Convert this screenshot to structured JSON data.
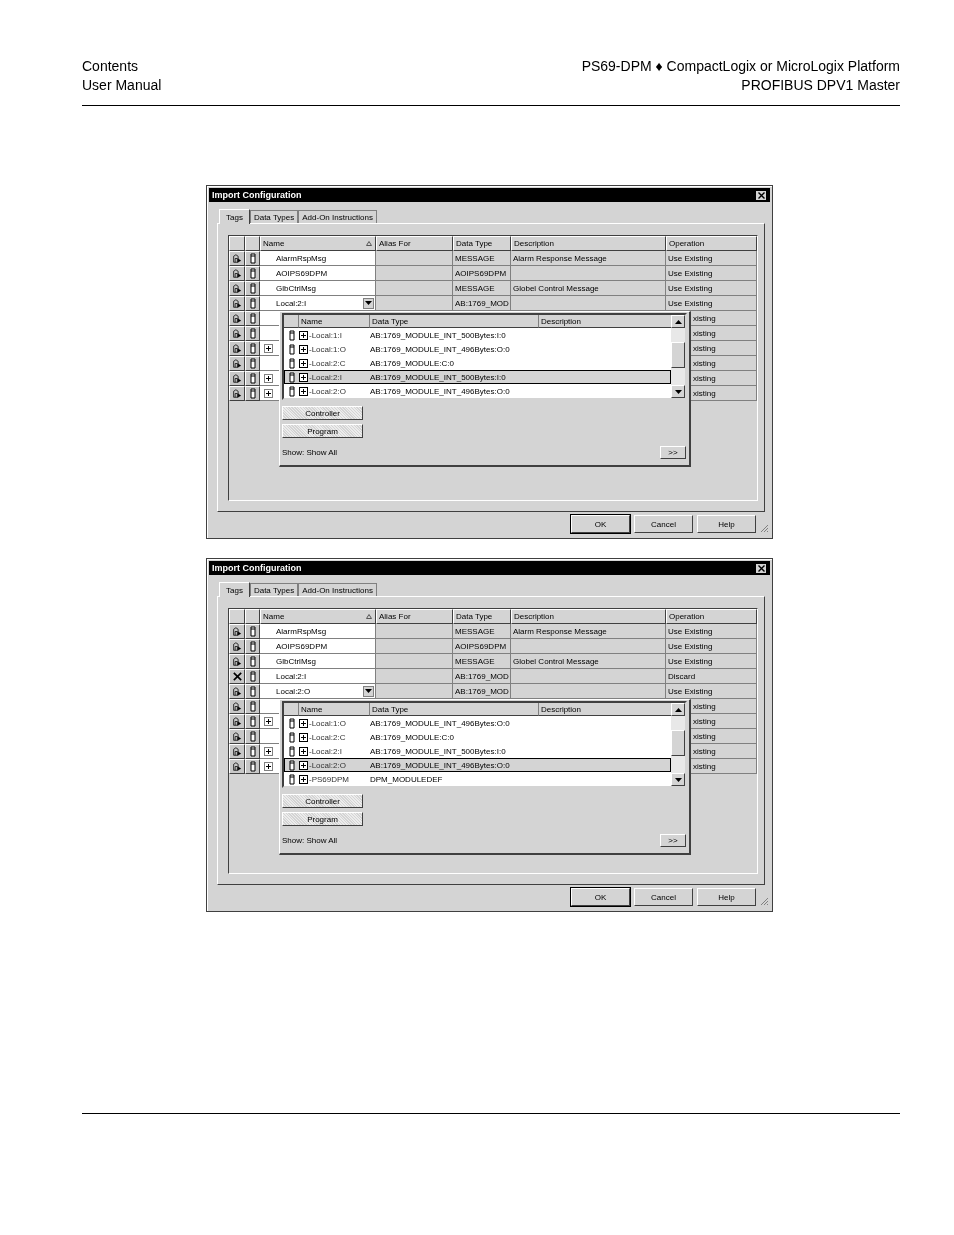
{
  "header": {
    "left": [
      "Contents",
      "User Manual"
    ],
    "right": [
      "PS69-DPM ♦ CompactLogix or MicroLogix Platform",
      "PROFIBUS DPV1 Master"
    ]
  },
  "dialogs": [
    {
      "title": "Import Configuration",
      "tabs": [
        {
          "label": "Tags",
          "selected": true
        },
        {
          "label": "Data Types",
          "selected": false
        },
        {
          "label": "Add-On Instructions",
          "selected": false
        }
      ],
      "grid": {
        "columns": [
          "Name",
          "Alias For",
          "Data Type",
          "Description",
          "Operation"
        ],
        "rows": [
          {
            "kind": "import",
            "expandable": false,
            "editing": false,
            "name": "AlarmRspMsg",
            "data_type": "MESSAGE",
            "description": "Alarm Response Message",
            "operation": "Use Existing"
          },
          {
            "kind": "import",
            "expandable": false,
            "editing": false,
            "name": "AOIPS69DPM",
            "data_type": "AOIPS69DPM",
            "operation": "Use Existing"
          },
          {
            "kind": "import",
            "expandable": false,
            "editing": false,
            "name": "GlbCtrlMsg",
            "data_type": "MESSAGE",
            "description": "Globel Control Message",
            "operation": "Use Existing"
          },
          {
            "kind": "import",
            "expandable": false,
            "editing": true,
            "name": "Local:2:I",
            "data_type": "AB:1769_MOD",
            "operation": "Use Existing"
          },
          {
            "kind": "import",
            "expandable": false,
            "editing": false,
            "operation": "xisting"
          },
          {
            "kind": "import",
            "expandable": false,
            "editing": false,
            "operation": "xisting"
          },
          {
            "kind": "import",
            "expandable": true,
            "editing": false,
            "operation": "xisting"
          },
          {
            "kind": "import",
            "expandable": false,
            "editing": false,
            "operation": "xisting"
          },
          {
            "kind": "import",
            "expandable": true,
            "editing": false,
            "operation": "xisting"
          },
          {
            "kind": "import",
            "expandable": true,
            "editing": false,
            "operation": "xisting"
          }
        ]
      },
      "popup": {
        "columns": [
          "Name",
          "Data Type",
          "Description"
        ],
        "items": [
          {
            "name": "-Local:1:I",
            "data_type": "AB:1769_MODULE_INT_500Bytes:I:0",
            "selected": false
          },
          {
            "name": "-Local:1:O",
            "data_type": "AB:1769_MODULE_INT_496Bytes:O:0",
            "selected": false
          },
          {
            "name": "-Local:2:C",
            "data_type": "AB:1769_MODULE:C:0",
            "selected": false
          },
          {
            "name": "-Local:2:I",
            "data_type": "AB:1769_MODULE_INT_500Bytes:I:0",
            "selected": true
          },
          {
            "name": "-Local:2:O",
            "data_type": "AB:1769_MODULE_INT_496Bytes:O:0",
            "selected": false
          }
        ],
        "buttons": [
          "Controller",
          "Program"
        ],
        "show": "Show: Show All",
        "more": ">>"
      },
      "buttons": [
        "OK",
        "Cancel",
        "Help"
      ]
    },
    {
      "title": "Import Configuration",
      "tabs": [
        {
          "label": "Tags",
          "selected": true
        },
        {
          "label": "Data Types",
          "selected": false
        },
        {
          "label": "Add-On Instructions",
          "selected": false
        }
      ],
      "grid": {
        "columns": [
          "Name",
          "Alias For",
          "Data Type",
          "Description",
          "Operation"
        ],
        "rows": [
          {
            "kind": "import",
            "expandable": false,
            "editing": false,
            "name": "AlarmRspMsg",
            "data_type": "MESSAGE",
            "description": "Alarm Response Message",
            "operation": "Use Existing"
          },
          {
            "kind": "import",
            "expandable": false,
            "editing": false,
            "name": "AOIPS69DPM",
            "data_type": "AOIPS69DPM",
            "operation": "Use Existing"
          },
          {
            "kind": "import",
            "expandable": false,
            "editing": false,
            "name": "GlbCtrlMsg",
            "data_type": "MESSAGE",
            "description": "Globel Control Message",
            "operation": "Use Existing"
          },
          {
            "kind": "discard",
            "expandable": false,
            "editing": false,
            "name": "Local:2:I",
            "data_type": "AB:1769_MOD",
            "operation": "Discard"
          },
          {
            "kind": "import",
            "expandable": false,
            "editing": true,
            "name": "Local:2:O",
            "data_type": "AB:1769_MOD",
            "operation": "Use Existing"
          },
          {
            "kind": "import",
            "expandable": false,
            "editing": false,
            "operation": "xisting"
          },
          {
            "kind": "import",
            "expandable": true,
            "editing": false,
            "operation": "xisting"
          },
          {
            "kind": "import",
            "expandable": false,
            "editing": false,
            "operation": "xisting"
          },
          {
            "kind": "import",
            "expandable": true,
            "editing": false,
            "operation": "xisting"
          },
          {
            "kind": "import",
            "expandable": true,
            "editing": false,
            "operation": "xisting"
          }
        ]
      },
      "popup": {
        "columns": [
          "Name",
          "Data Type",
          "Description"
        ],
        "items": [
          {
            "name": "-Local:1:O",
            "data_type": "AB:1769_MODULE_INT_496Bytes:O:0",
            "selected": false
          },
          {
            "name": "-Local:2:C",
            "data_type": "AB:1769_MODULE:C:0",
            "selected": false
          },
          {
            "name": "-Local:2:I",
            "data_type": "AB:1769_MODULE_INT_500Bytes:I:0",
            "selected": false
          },
          {
            "name": "-Local:2:O",
            "data_type": "AB:1769_MODULE_INT_496Bytes:O:0",
            "selected": true
          },
          {
            "name": "-PS69DPM",
            "data_type": "DPM_MODULEDEF",
            "selected": false
          }
        ],
        "buttons": [
          "Controller",
          "Program"
        ],
        "show": "Show: Show All",
        "more": ">>"
      },
      "buttons": [
        "OK",
        "Cancel",
        "Help"
      ]
    }
  ]
}
